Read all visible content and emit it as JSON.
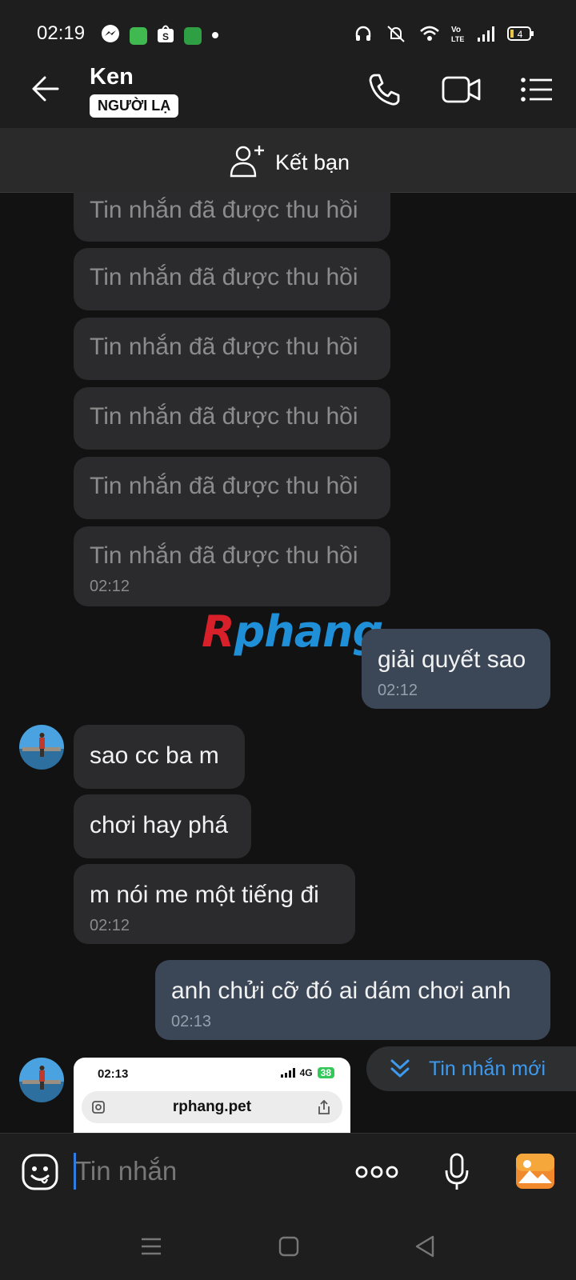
{
  "status_bar": {
    "time": "02:19",
    "battery": "4",
    "icons_left": [
      "messenger-icon",
      "grid-app-icon",
      "shopee-icon",
      "battery-app-icon",
      "dot-icon"
    ],
    "icons_right": [
      "headset-icon",
      "mute-icon",
      "wifi-icon",
      "volte-icon",
      "signal-icon",
      "battery-icon"
    ]
  },
  "header": {
    "contact_name": "Ken",
    "stranger_badge": "NGƯỜI LẠ"
  },
  "friend_bar": {
    "label": "Kết bạn"
  },
  "messages": {
    "recalled": [
      "Tin nhắn đã được thu hồi",
      "Tin nhắn đã được thu hồi",
      "Tin nhắn đã được thu hồi",
      "Tin nhắn đã được thu hồi",
      "Tin nhắn đã được thu hồi",
      "Tin nhắn đã được thu hồi"
    ],
    "recalled_time": "02:12",
    "out1": {
      "text": "giải quyết sao",
      "time": "02:12"
    },
    "in_group": {
      "lines": [
        "sao cc ba m",
        "chơi hay phá",
        "m nói me một tiếng đi"
      ],
      "time": "02:12"
    },
    "out2": {
      "text": "anh chửi cỡ đó ai dám chơi anh",
      "time": "02:13"
    },
    "image_preview": {
      "time": "02:13",
      "network": "4G",
      "battery": "38",
      "url": "rphang.pet"
    }
  },
  "watermark": {
    "r": "R",
    "rest": "phang"
  },
  "new_message_pill": {
    "label": "Tin nhắn mới"
  },
  "composer": {
    "placeholder": "Tin nhắn"
  },
  "colors": {
    "background": "#121212",
    "incoming_bubble": "#2b2b2d",
    "outgoing_bubble": "#3b4656",
    "accent": "#3d9aef"
  }
}
